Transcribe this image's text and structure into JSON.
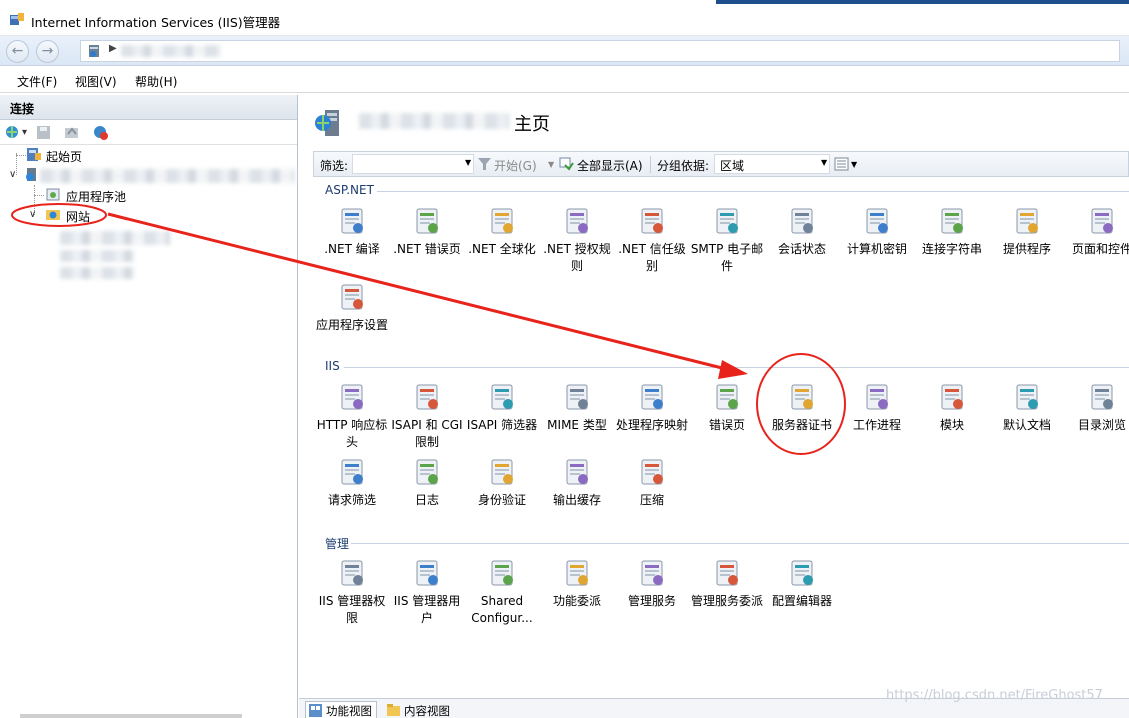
{
  "window": {
    "title": "Internet Information Services (IIS)管理器"
  },
  "menu": {
    "items": [
      "文件(F)",
      "视图(V)",
      "帮助(H)"
    ]
  },
  "connections": {
    "header": "连接",
    "tree": {
      "start_page": "起始页",
      "app_pools": "应用程序池",
      "sites": "网站"
    }
  },
  "main": {
    "title_suffix": "主页",
    "filter": {
      "label": "筛选:",
      "go": "开始(G)",
      "show_all": "全部显示(A)",
      "group_by_label": "分组依据:",
      "group_by_value": "区域"
    },
    "groups": [
      {
        "name": "ASP.NET",
        "items": [
          {
            "label": ".NET 编译",
            "icon": "net-compile-icon"
          },
          {
            "label": ".NET 错误页",
            "icon": "net-error-pages-icon"
          },
          {
            "label": ".NET 全球化",
            "icon": "net-globalization-icon"
          },
          {
            "label": ".NET 授权规则",
            "icon": "net-authorization-icon"
          },
          {
            "label": ".NET 信任级别",
            "icon": "net-trust-icon"
          },
          {
            "label": "SMTP 电子邮件",
            "icon": "smtp-email-icon"
          },
          {
            "label": "会话状态",
            "icon": "session-state-icon"
          },
          {
            "label": "计算机密钥",
            "icon": "machine-key-icon"
          },
          {
            "label": "连接字符串",
            "icon": "connection-strings-icon"
          },
          {
            "label": "提供程序",
            "icon": "providers-icon"
          },
          {
            "label": "页面和控件",
            "icon": "pages-controls-icon"
          },
          {
            "label": "应用程序设置",
            "icon": "app-settings-icon"
          }
        ]
      },
      {
        "name": "IIS",
        "items": [
          {
            "label": "HTTP 响应标头",
            "icon": "http-headers-icon"
          },
          {
            "label": "ISAPI 和 CGI 限制",
            "icon": "isapi-cgi-icon"
          },
          {
            "label": "ISAPI 筛选器",
            "icon": "isapi-filter-icon"
          },
          {
            "label": "MIME 类型",
            "icon": "mime-types-icon"
          },
          {
            "label": "处理程序映射",
            "icon": "handler-mappings-icon"
          },
          {
            "label": "错误页",
            "icon": "error-pages-icon"
          },
          {
            "label": "服务器证书",
            "icon": "server-certificates-icon"
          },
          {
            "label": "工作进程",
            "icon": "worker-processes-icon"
          },
          {
            "label": "模块",
            "icon": "modules-icon"
          },
          {
            "label": "默认文档",
            "icon": "default-document-icon"
          },
          {
            "label": "目录浏览",
            "icon": "directory-browsing-icon"
          },
          {
            "label": "请求筛选",
            "icon": "request-filtering-icon"
          },
          {
            "label": "日志",
            "icon": "logging-icon"
          },
          {
            "label": "身份验证",
            "icon": "authentication-icon"
          },
          {
            "label": "输出缓存",
            "icon": "output-caching-icon"
          },
          {
            "label": "压缩",
            "icon": "compression-icon"
          }
        ]
      },
      {
        "name": "管理",
        "items": [
          {
            "label": "IIS 管理器权限",
            "icon": "iis-manager-permissions-icon"
          },
          {
            "label": "IIS 管理器用户",
            "icon": "iis-manager-users-icon"
          },
          {
            "label": "Shared Configur...",
            "icon": "shared-configuration-icon"
          },
          {
            "label": "功能委派",
            "icon": "feature-delegation-icon"
          },
          {
            "label": "管理服务",
            "icon": "management-service-icon"
          },
          {
            "label": "管理服务委派",
            "icon": "management-service-delegation-icon"
          },
          {
            "label": "配置编辑器",
            "icon": "configuration-editor-icon"
          }
        ]
      }
    ],
    "tabs": {
      "features_view": "功能视图",
      "content_view": "内容视图"
    }
  },
  "watermark": "https://blog.csdn.net/FireGhost57",
  "colors": {
    "annotation": "#e8231b",
    "accent": "#1e4f8c"
  }
}
